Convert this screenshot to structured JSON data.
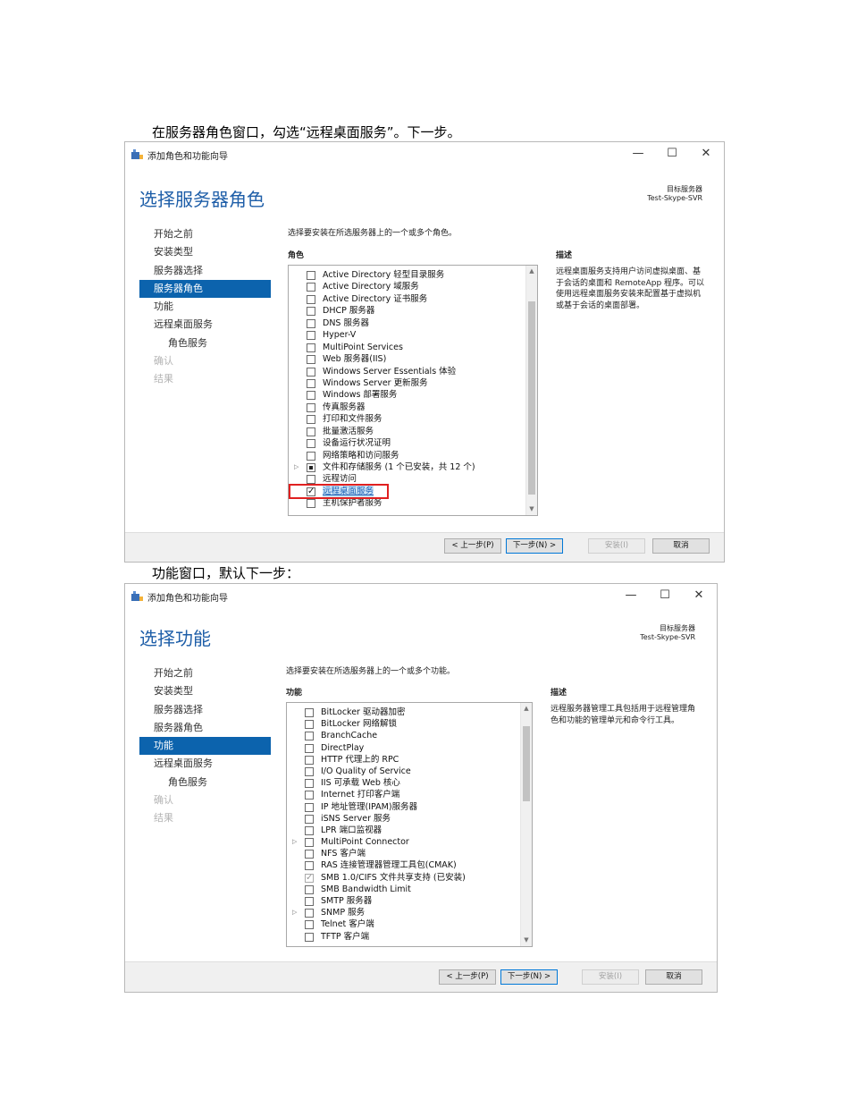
{
  "captions": {
    "first": "在服务器角色窗口，勾选“远程桌面服务”。下一步。",
    "second": "功能窗口，默认下一步："
  },
  "window_common": {
    "title": "添加角色和功能向导",
    "minimize_glyph": "—",
    "maximize_glyph": "☐",
    "close_glyph": "✕",
    "target_label": "目标服务器",
    "target_server": "Test-Skype-SVR",
    "buttons": {
      "prev": "< 上一步(P)",
      "next": "下一步(N) >",
      "install": "安装(I)",
      "cancel": "取消"
    }
  },
  "roles_window": {
    "page_title": "选择服务器角色",
    "nav": [
      "开始之前",
      "安装类型",
      "服务器选择",
      "服务器角色",
      "功能",
      "远程桌面服务",
      "角色服务",
      "确认",
      "结果"
    ],
    "instruction": "选择要安装在所选服务器上的一个或多个角色。",
    "list_header": "角色",
    "desc_header": "描述",
    "description": "远程桌面服务支持用户访问虚拟桌面、基于会话的桌面和 RemoteApp 程序。可以使用远程桌面服务安装来配置基于虚拟机或基于会话的桌面部署。",
    "roles": [
      {
        "label": "Active Directory 轻型目录服务",
        "state": "unchecked",
        "expander": ""
      },
      {
        "label": "Active Directory 域服务",
        "state": "unchecked",
        "expander": ""
      },
      {
        "label": "Active Directory 证书服务",
        "state": "unchecked",
        "expander": ""
      },
      {
        "label": "DHCP 服务器",
        "state": "unchecked",
        "expander": ""
      },
      {
        "label": "DNS 服务器",
        "state": "unchecked",
        "expander": ""
      },
      {
        "label": "Hyper-V",
        "state": "unchecked",
        "expander": ""
      },
      {
        "label": "MultiPoint Services",
        "state": "unchecked",
        "expander": ""
      },
      {
        "label": "Web 服务器(IIS)",
        "state": "unchecked",
        "expander": ""
      },
      {
        "label": "Windows Server Essentials 体验",
        "state": "unchecked",
        "expander": ""
      },
      {
        "label": "Windows Server 更新服务",
        "state": "unchecked",
        "expander": ""
      },
      {
        "label": "Windows 部署服务",
        "state": "unchecked",
        "expander": ""
      },
      {
        "label": "传真服务器",
        "state": "unchecked",
        "expander": ""
      },
      {
        "label": "打印和文件服务",
        "state": "unchecked",
        "expander": ""
      },
      {
        "label": "批量激活服务",
        "state": "unchecked",
        "expander": ""
      },
      {
        "label": "设备运行状况证明",
        "state": "unchecked",
        "expander": ""
      },
      {
        "label": "网络策略和访问服务",
        "state": "unchecked",
        "expander": ""
      },
      {
        "label": "文件和存储服务 (1 个已安装，共 12 个)",
        "state": "partial",
        "expander": "▷"
      },
      {
        "label": "远程访问",
        "state": "unchecked",
        "expander": ""
      },
      {
        "label": "远程桌面服务",
        "state": "checked",
        "expander": ""
      },
      {
        "label": "主机保护者服务",
        "state": "unchecked",
        "expander": ""
      }
    ]
  },
  "features_window": {
    "page_title": "选择功能",
    "nav": [
      "开始之前",
      "安装类型",
      "服务器选择",
      "服务器角色",
      "功能",
      "远程桌面服务",
      "角色服务",
      "确认",
      "结果"
    ],
    "instruction": "选择要安装在所选服务器上的一个或多个功能。",
    "list_header": "功能",
    "desc_header": "描述",
    "description": "远程服务器管理工具包括用于远程管理角色和功能的管理单元和命令行工具。",
    "features": [
      {
        "label": "BitLocker 驱动器加密",
        "state": "unchecked",
        "expander": ""
      },
      {
        "label": "BitLocker 网络解锁",
        "state": "unchecked",
        "expander": ""
      },
      {
        "label": "BranchCache",
        "state": "unchecked",
        "expander": ""
      },
      {
        "label": "DirectPlay",
        "state": "unchecked",
        "expander": ""
      },
      {
        "label": "HTTP 代理上的 RPC",
        "state": "unchecked",
        "expander": ""
      },
      {
        "label": "I/O Quality of Service",
        "state": "unchecked",
        "expander": ""
      },
      {
        "label": "IIS 可承载 Web 核心",
        "state": "unchecked",
        "expander": ""
      },
      {
        "label": "Internet 打印客户端",
        "state": "unchecked",
        "expander": ""
      },
      {
        "label": "IP 地址管理(IPAM)服务器",
        "state": "unchecked",
        "expander": ""
      },
      {
        "label": "iSNS Server 服务",
        "state": "unchecked",
        "expander": ""
      },
      {
        "label": "LPR 端口监视器",
        "state": "unchecked",
        "expander": ""
      },
      {
        "label": "MultiPoint Connector",
        "state": "unchecked",
        "expander": "▷"
      },
      {
        "label": "NFS 客户端",
        "state": "unchecked",
        "expander": ""
      },
      {
        "label": "RAS 连接管理器管理工具包(CMAK)",
        "state": "unchecked",
        "expander": ""
      },
      {
        "label": "SMB 1.0/CIFS 文件共享支持 (已安装)",
        "state": "grayed",
        "expander": ""
      },
      {
        "label": "SMB Bandwidth Limit",
        "state": "unchecked",
        "expander": ""
      },
      {
        "label": "SMTP 服务器",
        "state": "unchecked",
        "expander": ""
      },
      {
        "label": "SNMP 服务",
        "state": "unchecked",
        "expander": "▷"
      },
      {
        "label": "Telnet 客户端",
        "state": "unchecked",
        "expander": ""
      },
      {
        "label": "TFTP 客户端",
        "state": "unchecked",
        "expander": ""
      }
    ]
  },
  "colors": {
    "accent": "#0c63ad",
    "title_blue": "#1e5ea8",
    "highlight_box": "#e02020"
  }
}
